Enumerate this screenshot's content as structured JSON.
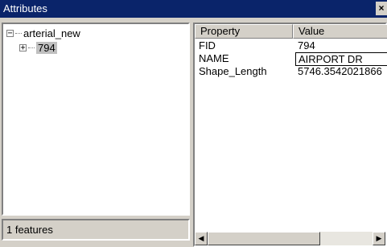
{
  "window": {
    "title": "Attributes",
    "close_glyph": "×"
  },
  "tree": {
    "root_label": "arterial_new",
    "root_expander": "−",
    "child_label": "794",
    "child_expander": "+"
  },
  "status": {
    "text": "1 features"
  },
  "grid": {
    "headers": [
      "Property",
      "Value"
    ],
    "rows": [
      {
        "property": "FID",
        "value": "794"
      },
      {
        "property": "NAME",
        "value": "AIRPORT DR"
      },
      {
        "property": "Shape_Length",
        "value": "5746.3542021866"
      }
    ]
  },
  "scroll": {
    "left_glyph": "◀",
    "right_glyph": "▶"
  }
}
